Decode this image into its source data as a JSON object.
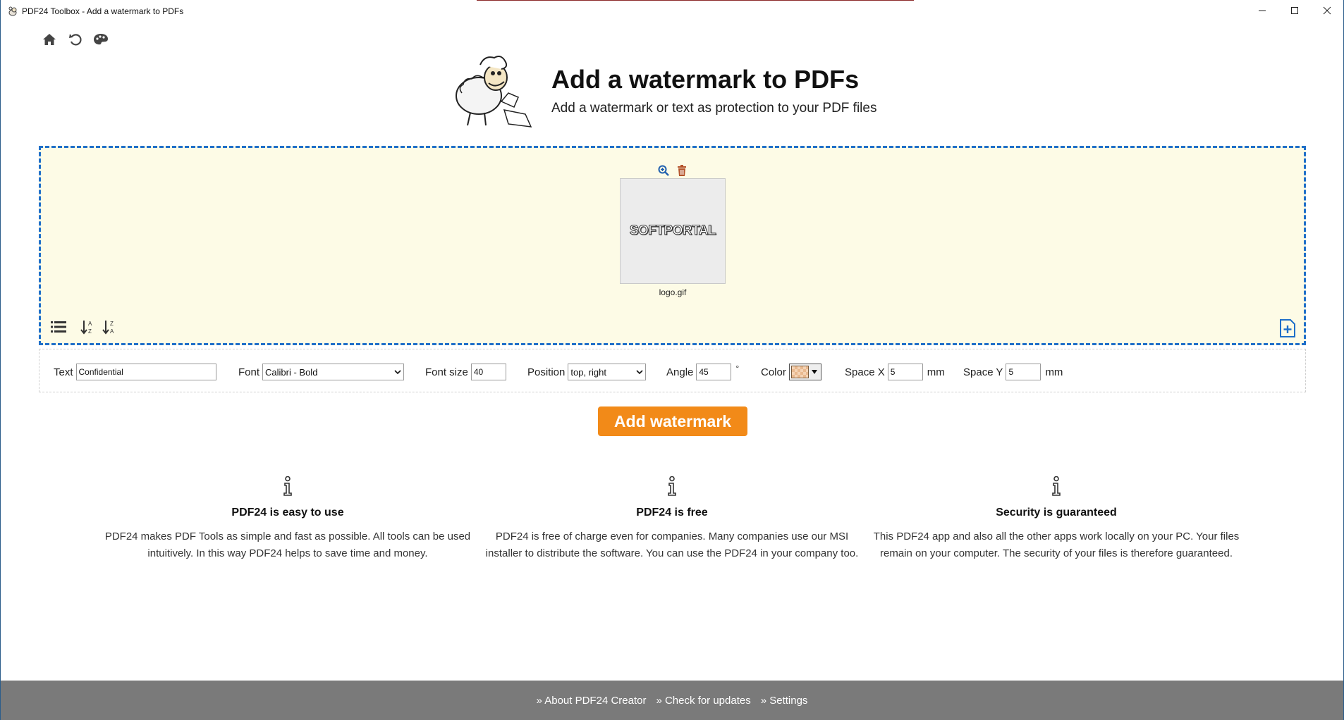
{
  "window": {
    "title": "PDF24 Toolbox - Add a watermark to PDFs",
    "minimize_icon": "minimize-icon",
    "maximize_icon": "maximize-icon",
    "close_icon": "close-icon"
  },
  "nav": {
    "home_icon": "home-icon",
    "back_icon": "undo-icon",
    "theme_icon": "palette-icon"
  },
  "header": {
    "title": "Add a watermark to PDFs",
    "subtitle": "Add a watermark or text as protection to your PDF files"
  },
  "dropzone": {
    "file": {
      "name": "logo.gif",
      "thumbnail_text": "SOFTPORTAL",
      "zoom_icon": "zoom-in-icon",
      "delete_icon": "trash-icon"
    },
    "tools": {
      "list_icon": "list-icon",
      "sort_az_icon": "sort-az-icon",
      "sort_za_icon": "sort-za-icon",
      "add_file_icon": "add-file-icon"
    }
  },
  "options": {
    "text_label": "Text",
    "text_value": "Confidential",
    "font_label": "Font",
    "font_value": "Calibri - Bold",
    "font_size_label": "Font size",
    "font_size_value": "40",
    "position_label": "Position",
    "position_value": "top, right",
    "angle_label": "Angle",
    "angle_value": "45",
    "angle_unit": "°",
    "color_label": "Color",
    "space_x_label": "Space X",
    "space_x_value": "5",
    "space_x_unit": "mm",
    "space_y_label": "Space Y",
    "space_y_value": "5",
    "space_y_unit": "mm"
  },
  "action": {
    "label": "Add watermark",
    "color": "#f28a18"
  },
  "info": [
    {
      "title": "PDF24 is easy to use",
      "text": "PDF24 makes PDF Tools as simple and fast as possible. All tools can be used intuitively. In this way PDF24 helps to save time and money."
    },
    {
      "title": "PDF24 is free",
      "text": "PDF24 is free of charge even for companies. Many companies use our MSI installer to distribute the software. You can use the PDF24 in your company too."
    },
    {
      "title": "Security is guaranteed",
      "text": "This PDF24 app and also all the other apps work locally on your PC. Your files remain on your computer. The security of your files is therefore guaranteed."
    }
  ],
  "footer": {
    "about": "» About PDF24 Creator",
    "updates": "» Check for updates",
    "settings": "» Settings"
  },
  "colors": {
    "dropzone_border": "#1f6fc9",
    "dropzone_bg": "#fdfbe6",
    "footer_bg": "#7a7a7a"
  }
}
